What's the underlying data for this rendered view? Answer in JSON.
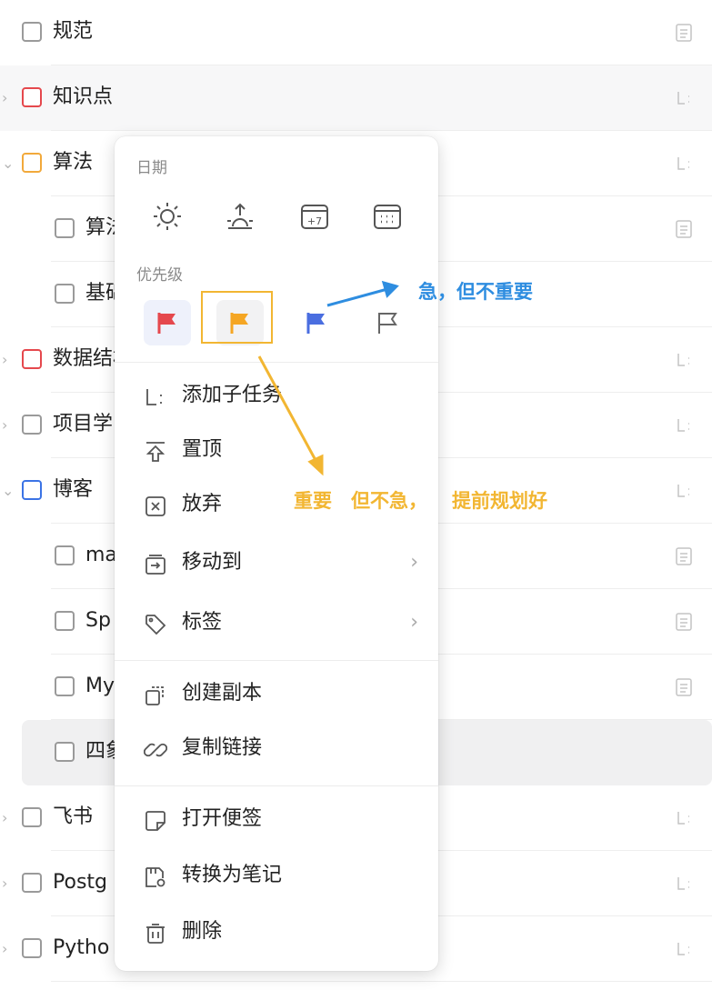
{
  "tasks": [
    {
      "title": "规范",
      "checkbox": "gray",
      "expand": "",
      "side_icon": "note-icon"
    },
    {
      "title": "知识点",
      "checkbox": "red",
      "expand": "›",
      "side_icon": "subtask-icon"
    },
    {
      "title": "算法",
      "checkbox": "orange",
      "expand": "⌄",
      "side_icon": "subtask-icon"
    },
    {
      "title": "算法",
      "checkbox": "gray",
      "expand": "",
      "side_icon": "note-icon",
      "indent": true
    },
    {
      "title": "基础",
      "checkbox": "gray",
      "expand": "",
      "side_icon": "",
      "indent": true
    },
    {
      "title": "数据结构",
      "checkbox": "red",
      "expand": "›",
      "side_icon": "subtask-icon"
    },
    {
      "title": "项目学习",
      "checkbox": "gray",
      "expand": "›",
      "side_icon": "subtask-icon"
    },
    {
      "title": "博客",
      "checkbox": "blue",
      "expand": "⌄",
      "side_icon": "subtask-icon"
    },
    {
      "title": "ma",
      "checkbox": "gray",
      "expand": "",
      "side_icon": "note-icon",
      "indent": true
    },
    {
      "title": "Sp",
      "checkbox": "gray",
      "expand": "",
      "side_icon": "note-icon",
      "indent": true
    },
    {
      "title": "My",
      "checkbox": "gray",
      "expand": "",
      "side_icon": "note-icon",
      "indent": true
    },
    {
      "title": "四象",
      "checkbox": "gray",
      "expand": "",
      "side_icon": "",
      "indent": true
    },
    {
      "title": "飞书",
      "checkbox": "gray",
      "expand": "›",
      "side_icon": "subtask-icon"
    },
    {
      "title": "Postg",
      "checkbox": "gray",
      "expand": "›",
      "side_icon": "subtask-icon"
    },
    {
      "title": "Pytho",
      "checkbox": "gray",
      "expand": "›",
      "side_icon": "subtask-icon"
    }
  ],
  "menu": {
    "date_label": "日期",
    "priority_label": "优先级",
    "date_icons": [
      "today-sun-icon",
      "tomorrow-sunrise-icon",
      "next-week-plus7-icon",
      "calendar-icon"
    ],
    "plus7": "+7",
    "priority_flags": [
      {
        "name": "high",
        "color": "#e5484d"
      },
      {
        "name": "medium",
        "color": "#f5a623"
      },
      {
        "name": "low",
        "color": "#4a6ee0"
      },
      {
        "name": "none",
        "color": "#666666"
      }
    ],
    "items": [
      {
        "label": "添加子任务",
        "icon": "subtask-icon"
      },
      {
        "label": "置顶",
        "icon": "pin-top-icon"
      },
      {
        "label": "放弃",
        "icon": "abandon-x-icon"
      },
      {
        "label": "移动到",
        "icon": "move-to-icon",
        "chevron": "›"
      },
      {
        "label": "标签",
        "icon": "tag-icon",
        "chevron": "›"
      },
      {
        "label": "创建副本",
        "icon": "duplicate-icon"
      },
      {
        "label": "复制链接",
        "icon": "link-icon"
      },
      {
        "label": "打开便签",
        "icon": "sticky-note-icon"
      },
      {
        "label": "转换为笔记",
        "icon": "convert-note-icon"
      },
      {
        "label": "删除",
        "icon": "trash-icon"
      }
    ]
  },
  "annotations": {
    "blue_text": "急，但不重要",
    "orange_text_1": "重要",
    "orange_text_2": "但不急，",
    "orange_text_3": "提前规划好",
    "blue_color": "#2e8de0",
    "orange_color": "#f2b632"
  }
}
